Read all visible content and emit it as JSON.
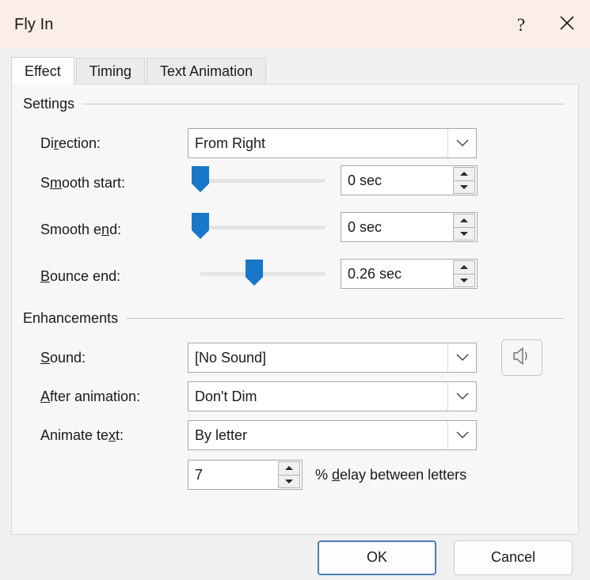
{
  "window": {
    "title": "Fly In",
    "help_label": "?",
    "close_label": "✕",
    "help_icon": "question-mark-icon",
    "close_icon": "close-icon"
  },
  "tabs": [
    {
      "label": "Effect",
      "active": true
    },
    {
      "label": "Timing",
      "active": false
    },
    {
      "label": "Text Animation",
      "active": false
    }
  ],
  "settings": {
    "group_title": "Settings",
    "direction": {
      "label_pre": "Di",
      "label_accel": "r",
      "label_post": "ection:",
      "value": "From Right"
    },
    "smooth_start": {
      "label_pre": "S",
      "label_accel": "m",
      "label_post": "ooth start:",
      "value": "0 sec",
      "slider_percent": 0
    },
    "smooth_end": {
      "label_pre": "Smooth e",
      "label_accel": "n",
      "label_post": "d:",
      "value": "0 sec",
      "slider_percent": 0
    },
    "bounce_end": {
      "label_pre": "",
      "label_accel": "B",
      "label_post": "ounce end:",
      "value": "0.26 sec",
      "slider_percent": 43
    }
  },
  "enhancements": {
    "group_title": "Enhancements",
    "sound": {
      "label_pre": "",
      "label_accel": "S",
      "label_post": "ound:",
      "value": "[No Sound]",
      "preview_icon": "speaker-icon"
    },
    "after_animation": {
      "label_pre": "",
      "label_accel": "A",
      "label_post": "fter animation:",
      "value": "Don't Dim"
    },
    "animate_text": {
      "label_pre": "Animate te",
      "label_accel": "x",
      "label_post": "t:",
      "value": "By letter"
    },
    "delay": {
      "value": "7",
      "label_pre": "% ",
      "label_accel": "d",
      "label_post": "elay between letters"
    }
  },
  "footer": {
    "ok_label": "OK",
    "cancel_label": "Cancel"
  },
  "colors": {
    "titlebar_bg": "#faeee7",
    "dialog_bg": "#f0f0f0",
    "panel_bg": "#f7f7f7",
    "accent_blue": "#1877c9",
    "focus_blue": "#4a7ebb"
  }
}
